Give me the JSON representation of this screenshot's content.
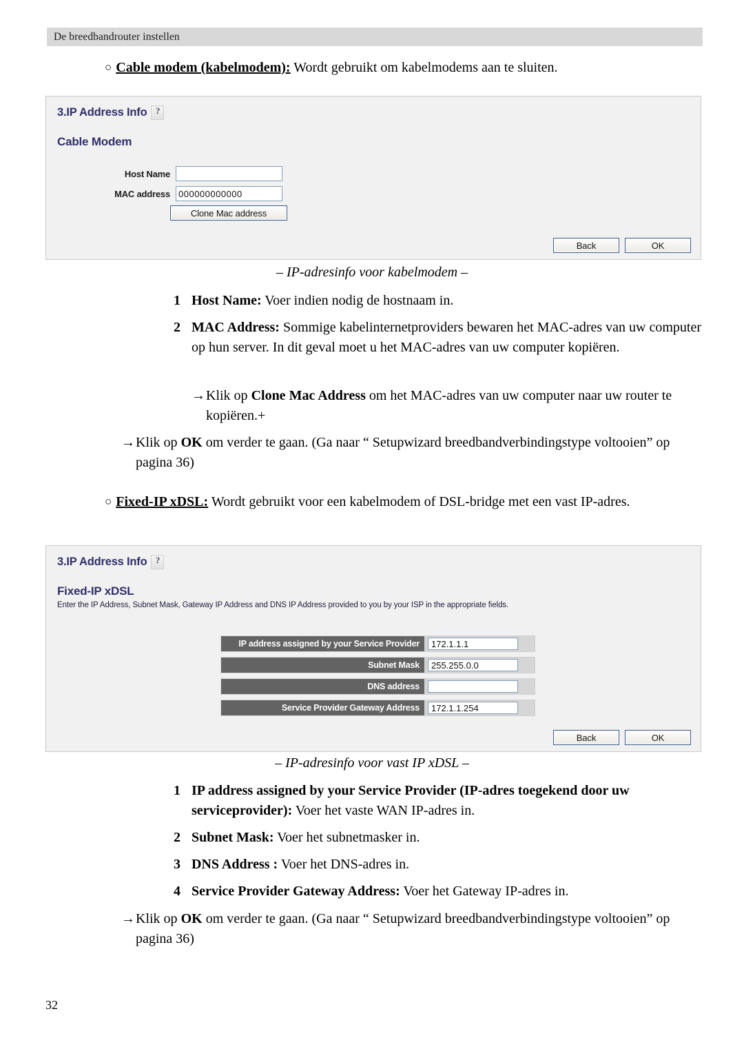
{
  "header": {
    "running_title": "De breedbandrouter instellen"
  },
  "page_number": "32",
  "bullets": {
    "cable_modem": {
      "marker": "○",
      "term": "Cable modem (kabelmodem):",
      "rest": " Wordt gebruikt om kabelmodems aan te sluiten."
    },
    "fixed_ip": {
      "marker": "○",
      "term": "Fixed-IP xDSL:",
      "rest": " Wordt gebruikt voor een kabelmodem of DSL-bridge met een vast IP-adres."
    }
  },
  "panel_cable_modem": {
    "title": "3.IP Address Info",
    "help_icon": "question-mark-icon",
    "subtitle": "Cable Modem",
    "fields": [
      {
        "label": "Host Name",
        "value": ""
      },
      {
        "label": "MAC address",
        "value": "000000000000"
      }
    ],
    "clone_button": "Clone Mac address",
    "back_button": "Back",
    "ok_button": "OK"
  },
  "caption_cable_modem": "– IP-adresinfo voor kabelmodem –",
  "list_cable_modem": [
    {
      "num": "1",
      "lead": "Host Name:",
      "text": " Voer indien nodig de hostnaam in."
    },
    {
      "num": "2",
      "lead": "MAC Address:",
      "text": " Sommige kabelinternetproviders bewaren het MAC-adres van uw computer op hun server. In dit geval moet u het MAC-adres van uw computer kopiëren."
    }
  ],
  "arrow_clone": {
    "arrow": "→",
    "pre": "Klik op ",
    "bold": "Clone Mac Address",
    "post": " om het MAC-adres van uw computer naar uw router te kopiëren.+"
  },
  "arrow_ok_1": {
    "arrow": "→",
    "pre": "Klik op ",
    "bold": "OK",
    "post": " om verder te gaan. (Ga naar “ Setupwizard breedbandverbindingstype voltooien” op pagina 36)"
  },
  "panel_fixed_ip": {
    "title": "3.IP Address Info",
    "help_icon": "question-mark-icon",
    "subtitle": "Fixed-IP xDSL",
    "description": "Enter the IP Address, Subnet Mask, Gateway IP Address and DNS IP Address provided to you by your ISP in the appropriate fields.",
    "fields": [
      {
        "label": "IP address assigned by your Service Provider",
        "value": "172.1.1.1"
      },
      {
        "label": "Subnet Mask",
        "value": "255.255.0.0"
      },
      {
        "label": "DNS address",
        "value": ""
      },
      {
        "label": "Service Provider Gateway Address",
        "value": "172.1.1.254"
      }
    ],
    "back_button": "Back",
    "ok_button": "OK"
  },
  "caption_fixed_ip": "– IP-adresinfo voor vast IP xDSL –",
  "list_fixed_ip": [
    {
      "num": "1",
      "lead": "IP address assigned by your Service Provider (IP-adres toegekend door uw serviceprovider):",
      "text": " Voer het vaste WAN IP-adres in."
    },
    {
      "num": "2",
      "lead": "Subnet Mask:",
      "text": " Voer het subnetmasker in."
    },
    {
      "num": "3",
      "lead": "DNS Address :",
      "text": " Voer het DNS-adres in."
    },
    {
      "num": "4",
      "lead": "Service Provider Gateway Address:",
      "text": " Voer het Gateway IP-adres in."
    }
  ],
  "arrow_ok_2": {
    "arrow": "→",
    "pre": "Klik op ",
    "bold": "OK",
    "post": " om verder te gaan. (Ga naar “ Setupwizard breedbandverbindingstype voltooien” op pagina 36)"
  },
  "colors": {
    "header_band": "#d8d8d8",
    "panel_bg": "#f1f1f1",
    "ui_heading": "#2f2f6b",
    "field_label_bar": "#636363",
    "input_border": "#7f9db9",
    "button_border": "#3a5a8c"
  }
}
